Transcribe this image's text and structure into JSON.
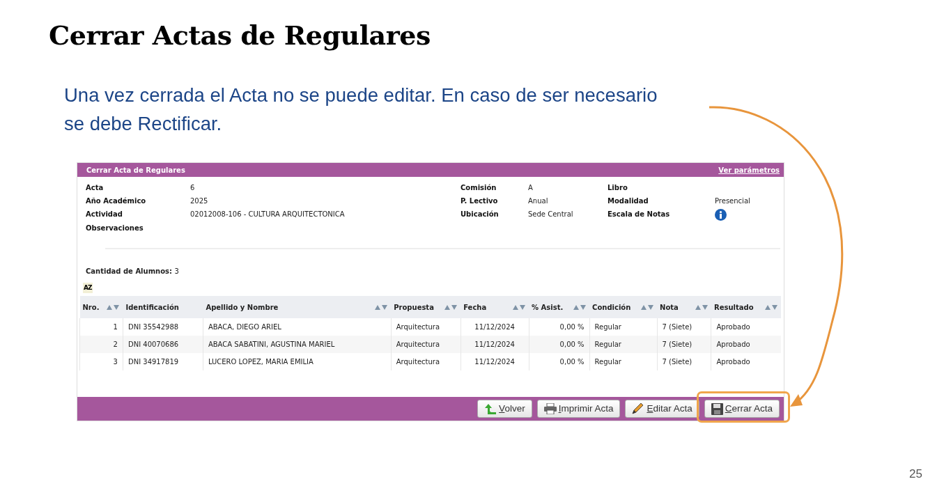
{
  "slide": {
    "title": "Cerrar Actas de Regulares",
    "text": "Una vez cerrada el Acta no se puede editar. En caso de ser necesario se debe Rectificar.",
    "page_number": "25"
  },
  "panel": {
    "title": "Cerrar Acta de Regulares",
    "link": "Ver parámetros",
    "fields": [
      [
        {
          "label": "Acta",
          "value": "6"
        },
        {
          "label": "Comisión",
          "value": "A"
        },
        {
          "label": "Libro"
        }
      ],
      [
        {
          "label": "Año Académico",
          "value": "2025"
        },
        {
          "label": "P. Lectivo",
          "value": "Anual"
        },
        {
          "label": "Modalidad",
          "value": "Presencial"
        }
      ],
      [
        {
          "label": "Actividad",
          "value": "02012008-106 - CULTURA ARQUITECTONICA"
        },
        {
          "label": "Ubicación",
          "value": "Sede Central"
        },
        {
          "label": "Escala de Notas",
          "kind": "info"
        }
      ],
      [
        {
          "label": "Observaciones"
        }
      ]
    ],
    "count_label": "Cantidad de Alumnos:",
    "count": "3",
    "sort_toggle": "AZ",
    "columns": [
      {
        "label": "Nro.",
        "sortable": true
      },
      {
        "label": "Identificación",
        "sortable": false
      },
      {
        "label": "Apellido y Nombre",
        "sortable": true
      },
      {
        "label": "Propuesta",
        "sortable": true
      },
      {
        "label": "Fecha",
        "sortable": true
      },
      {
        "label": "% Asist.",
        "sortable": true
      },
      {
        "label": "Condición",
        "sortable": true
      },
      {
        "label": "Nota",
        "sortable": true
      },
      {
        "label": "Resultado",
        "sortable": true
      }
    ],
    "rows": [
      [
        "1",
        "DNI 35542988",
        "ABACA, DIEGO ARIEL",
        "Arquitectura",
        "11/12/2024",
        "0,00 %",
        "Regular",
        "7 (Siete)",
        "Aprobado"
      ],
      [
        "2",
        "DNI 40070686",
        "ABACA SABATINI, AGUSTINA MARIEL",
        "Arquitectura",
        "11/12/2024",
        "0,00 %",
        "Regular",
        "7 (Siete)",
        "Aprobado"
      ],
      [
        "3",
        "DNI 34917819",
        "LUCERO LOPEZ, MARIA EMILIA",
        "Arquitectura",
        "11/12/2024",
        "0,00 %",
        "Regular",
        "7 (Siete)",
        "Aprobado"
      ]
    ],
    "buttons": [
      {
        "label": "Volver",
        "highlighted": false
      },
      {
        "label": "Imprimir Acta",
        "highlighted": false
      },
      {
        "label": "Editar Acta",
        "highlighted": false
      },
      {
        "label": "Cerrar Acta",
        "highlighted": true
      }
    ]
  }
}
